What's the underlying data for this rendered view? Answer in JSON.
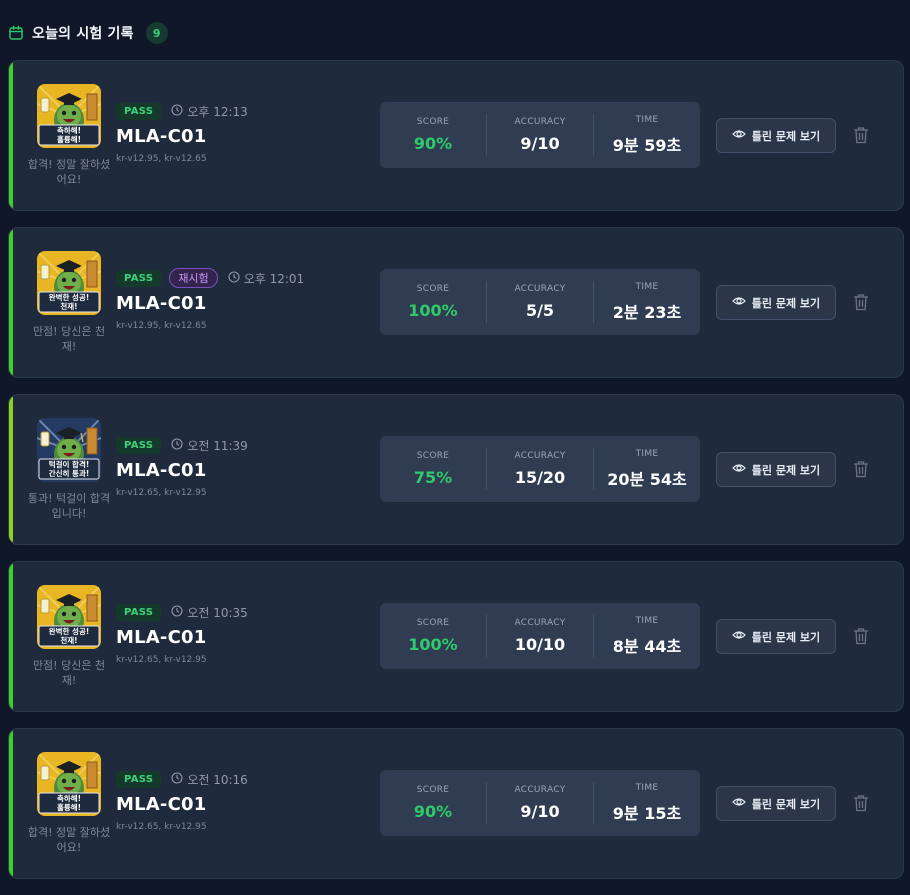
{
  "header": {
    "title": "오늘의 시험 기록",
    "count": "9"
  },
  "colors": {
    "accent_green": "#3fcf2a",
    "accent_lime": "#8fd11f",
    "score_green": "#2fcb6b"
  },
  "labels": {
    "score": "SCORE",
    "accuracy": "ACCURACY",
    "time": "TIME",
    "review_button": "틀린 문제 보기",
    "pass_badge": "PASS",
    "retry_badge": "재시험"
  },
  "records": [
    {
      "exam": "MLA-C01",
      "time": "오후 12:13",
      "versions": "kr-v12.95, kr-v12.65",
      "score": "90%",
      "accuracy": "9/10",
      "duration": "9분 59초",
      "caption": "합격! 정말 잘하셨어요!",
      "badge_text": [
        "축하해!",
        "훌륭해!"
      ],
      "retry": false,
      "theme": "gold",
      "accent": "green"
    },
    {
      "exam": "MLA-C01",
      "time": "오후 12:01",
      "versions": "kr-v12.95, kr-v12.65",
      "score": "100%",
      "accuracy": "5/5",
      "duration": "2분 23초",
      "caption": "만점! 당신은 천재!",
      "badge_text": [
        "완벽한 성공!",
        "천재!"
      ],
      "retry": true,
      "theme": "gold",
      "accent": "green"
    },
    {
      "exam": "MLA-C01",
      "time": "오전 11:39",
      "versions": "kr-v12.65, kr-v12.95",
      "score": "75%",
      "accuracy": "15/20",
      "duration": "20분 54초",
      "caption": "통과! 턱걸이 합격입니다!",
      "badge_text": [
        "턱걸이 합격!",
        "간신히 통과!"
      ],
      "retry": false,
      "theme": "night",
      "accent": "lime"
    },
    {
      "exam": "MLA-C01",
      "time": "오전 10:35",
      "versions": "kr-v12.65, kr-v12.95",
      "score": "100%",
      "accuracy": "10/10",
      "duration": "8분 44초",
      "caption": "만점! 당신은 천재!",
      "badge_text": [
        "완벽한 성공!",
        "천재!"
      ],
      "retry": false,
      "theme": "gold",
      "accent": "green"
    },
    {
      "exam": "MLA-C01",
      "time": "오전 10:16",
      "versions": "kr-v12.65, kr-v12.95",
      "score": "90%",
      "accuracy": "9/10",
      "duration": "9분 15초",
      "caption": "합격! 정말 잘하셨어요!",
      "badge_text": [
        "축하해!",
        "훌륭해!"
      ],
      "retry": false,
      "theme": "gold",
      "accent": "green"
    }
  ]
}
